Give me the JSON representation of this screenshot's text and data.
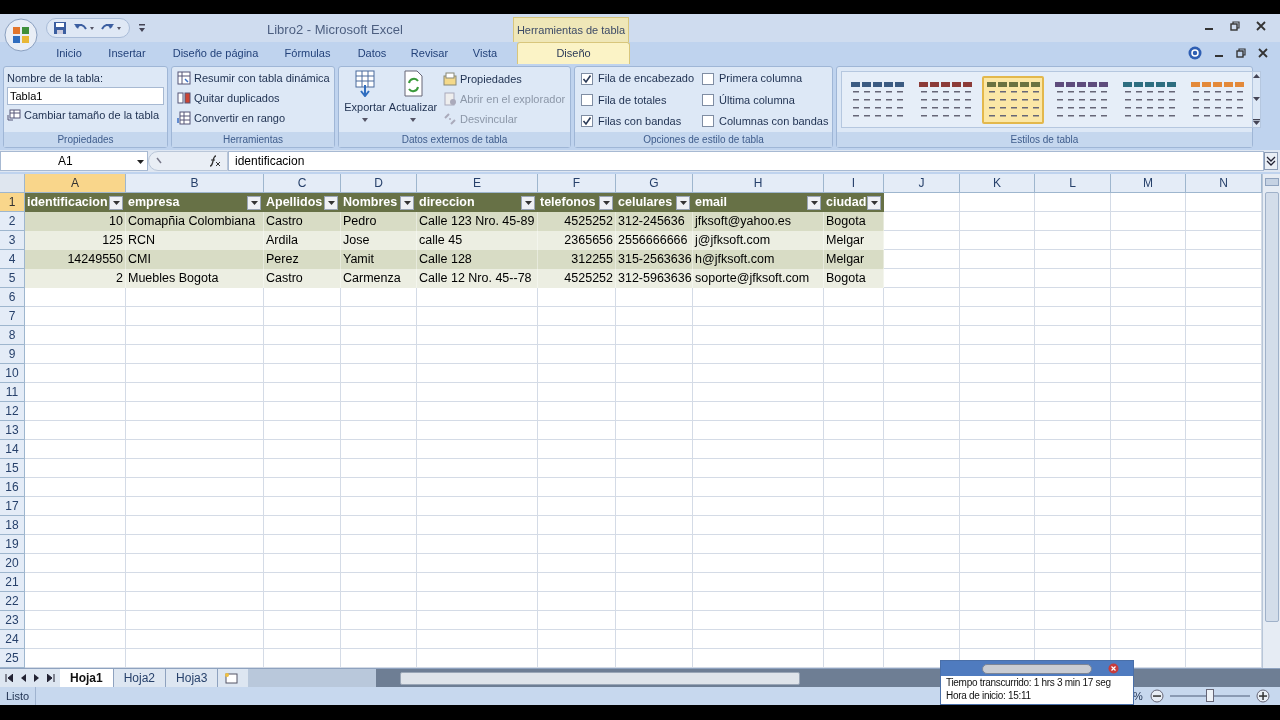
{
  "title_bar": {
    "title": "Libro2 - Microsoft Excel",
    "context_label": "Herramientas de tabla"
  },
  "tabs": [
    {
      "label": "Inicio",
      "selected": false
    },
    {
      "label": "Insertar",
      "selected": false
    },
    {
      "label": "Diseño de página",
      "selected": false
    },
    {
      "label": "Fórmulas",
      "selected": false
    },
    {
      "label": "Datos",
      "selected": false
    },
    {
      "label": "Revisar",
      "selected": false
    },
    {
      "label": "Vista",
      "selected": false
    },
    {
      "label": "Diseño",
      "selected": true
    }
  ],
  "ribbon": {
    "propiedades": {
      "name_label": "Nombre de la tabla:",
      "table_name": "Tabla1",
      "resize": "Cambiar tamaño de la tabla",
      "label": "Propiedades"
    },
    "herramientas": {
      "items": [
        "Resumir con tabla dinámica",
        "Quitar duplicados",
        "Convertir en rango"
      ],
      "label": "Herramientas"
    },
    "datos_externos": {
      "large": [
        "Exportar",
        "Actualizar"
      ],
      "items": [
        {
          "label": "Propiedades",
          "disabled": false
        },
        {
          "label": "Abrir en el explorador",
          "disabled": true
        },
        {
          "label": "Desvincular",
          "disabled": true
        }
      ],
      "label": "Datos externos de tabla"
    },
    "opciones": {
      "checkboxes": [
        {
          "label": "Fila de encabezado",
          "checked": true
        },
        {
          "label": "Fila de totales",
          "checked": false
        },
        {
          "label": "Filas con bandas",
          "checked": true
        },
        {
          "label": "Primera columna",
          "checked": false
        },
        {
          "label": "Última columna",
          "checked": false
        },
        {
          "label": "Columnas con bandas",
          "checked": false
        }
      ],
      "label": "Opciones de estilo de tabla"
    },
    "estilos": {
      "styles": [
        {
          "color": "#3b5b82",
          "selected": false
        },
        {
          "color": "#8c3b38",
          "selected": false
        },
        {
          "color": "#6b7340",
          "selected": true
        },
        {
          "color": "#5e4c7c",
          "selected": false
        },
        {
          "color": "#2e6e80",
          "selected": false
        },
        {
          "color": "#e3893a",
          "selected": false
        }
      ],
      "label": "Estilos de tabla"
    }
  },
  "formula_bar": {
    "name_box": "A1",
    "formula": "identificacion"
  },
  "columns": [
    {
      "letter": "A",
      "selected": true
    },
    {
      "letter": "B",
      "selected": false
    },
    {
      "letter": "C",
      "selected": false
    },
    {
      "letter": "D",
      "selected": false
    },
    {
      "letter": "E",
      "selected": false
    },
    {
      "letter": "F",
      "selected": false
    },
    {
      "letter": "G",
      "selected": false
    },
    {
      "letter": "H",
      "selected": false
    },
    {
      "letter": "I",
      "selected": false
    },
    {
      "letter": "J",
      "selected": false
    },
    {
      "letter": "K",
      "selected": false
    },
    {
      "letter": "L",
      "selected": false
    },
    {
      "letter": "M",
      "selected": false
    },
    {
      "letter": "N",
      "selected": false
    }
  ],
  "row_headers": [
    {
      "label": "1",
      "selected": true
    },
    {
      "label": "2",
      "selected": false
    },
    {
      "label": "3",
      "selected": false
    },
    {
      "label": "4",
      "selected": false
    },
    {
      "label": "5",
      "selected": false
    },
    {
      "label": "6",
      "selected": false
    },
    {
      "label": "7",
      "selected": false
    },
    {
      "label": "8",
      "selected": false
    },
    {
      "label": "9",
      "selected": false
    },
    {
      "label": "10",
      "selected": false
    },
    {
      "label": "11",
      "selected": false
    },
    {
      "label": "12",
      "selected": false
    },
    {
      "label": "13",
      "selected": false
    },
    {
      "label": "14",
      "selected": false
    },
    {
      "label": "15",
      "selected": false
    },
    {
      "label": "16",
      "selected": false
    },
    {
      "label": "17",
      "selected": false
    },
    {
      "label": "18",
      "selected": false
    },
    {
      "label": "19",
      "selected": false
    },
    {
      "label": "20",
      "selected": false
    },
    {
      "label": "21",
      "selected": false
    },
    {
      "label": "22",
      "selected": false
    },
    {
      "label": "23",
      "selected": false
    },
    {
      "label": "24",
      "selected": false
    },
    {
      "label": "25",
      "selected": false
    }
  ],
  "table": {
    "columns": [
      {
        "header": "identificacion",
        "kind": "number"
      },
      {
        "header": "empresa",
        "kind": "text"
      },
      {
        "header": "Apellidos",
        "kind": "text"
      },
      {
        "header": "Nombres",
        "kind": "text"
      },
      {
        "header": "direccion",
        "kind": "text"
      },
      {
        "header": "telefonos",
        "kind": "number"
      },
      {
        "header": "celulares",
        "kind": "text"
      },
      {
        "header": "email",
        "kind": "text"
      },
      {
        "header": "ciudad",
        "kind": "text"
      }
    ],
    "rows": [
      [
        "10",
        "Comapñia Colombiana",
        "Castro",
        "Pedro",
        "Calle 123 Nro. 45-89",
        "4525252",
        "312-245636",
        "jfksoft@yahoo.es",
        "Bogota"
      ],
      [
        "125",
        "RCN",
        "Ardila",
        "Jose",
        "calle 45",
        "2365656",
        "2556666666",
        "j@jfksoft.com",
        "Melgar"
      ],
      [
        "14249550",
        "CMI",
        "Perez",
        "Yamit",
        "Calle 128",
        "312255",
        "315-2563636",
        "h@jfksoft.com",
        "Melgar"
      ],
      [
        "2",
        "Muebles Bogota",
        "Castro",
        "Carmenza",
        "Calle 12 Nro. 45--78",
        "4525252",
        "312-5963636",
        "soporte@jfksoft.com",
        "Bogota"
      ]
    ]
  },
  "sheet_tabs": [
    {
      "label": "Hoja1",
      "selected": true
    },
    {
      "label": "Hoja2",
      "selected": false
    },
    {
      "label": "Hoja3",
      "selected": false
    }
  ],
  "status_bar": {
    "text": "Listo",
    "zoom_percent": "%",
    "zoom_slider": {
      "level": 0.5
    }
  },
  "timer_window": {
    "lines": [
      "Tiempo transcurrido: 1 hrs 3 min 17 seg",
      "Hora de inicio: 15:11"
    ]
  }
}
